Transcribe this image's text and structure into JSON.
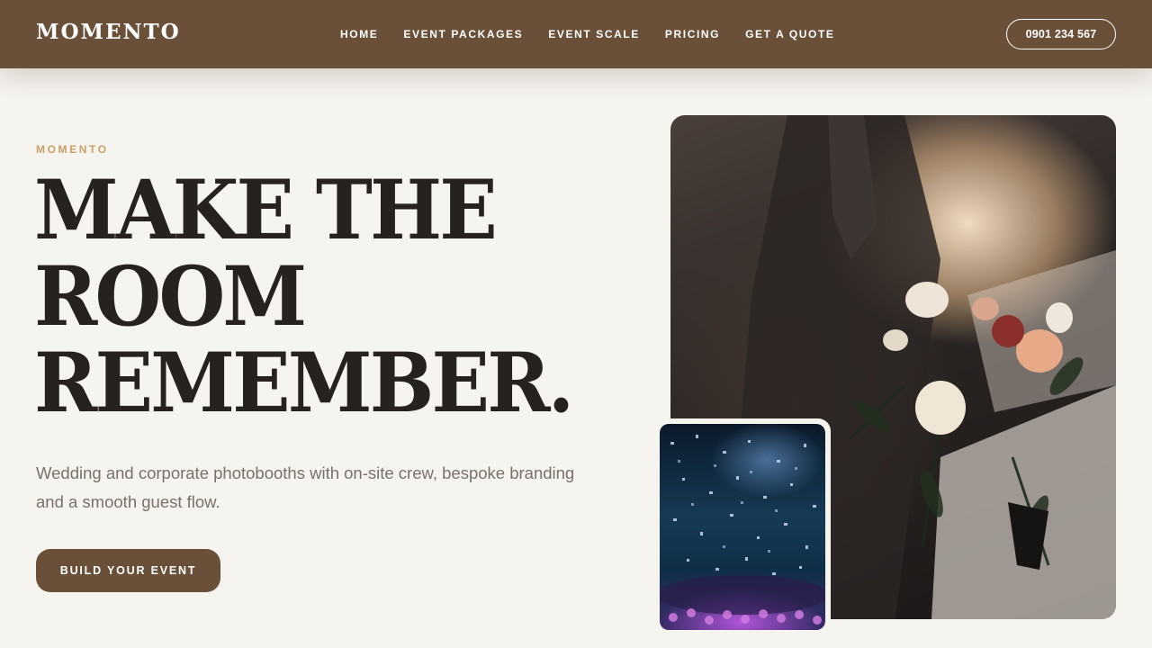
{
  "header": {
    "logo": "MOMENTO",
    "nav": [
      "HOME",
      "EVENT PACKAGES",
      "EVENT SCALE",
      "PRICING",
      "GET A QUOTE"
    ],
    "phone": "0901 234 567"
  },
  "hero": {
    "eyebrow": "MOMENTO",
    "headline": [
      "MAKE THE",
      "ROOM",
      "REMEMBER."
    ],
    "subtext": "Wedding and corporate photobooths with on-site crew, bespoke branding and a smooth guest flow.",
    "cta": "BUILD YOUR EVENT"
  },
  "colors": {
    "brand_brown": "#6a5038",
    "background": "#f6f4ef",
    "accent_gold": "#c9a06a",
    "text_dark": "#26221e"
  }
}
